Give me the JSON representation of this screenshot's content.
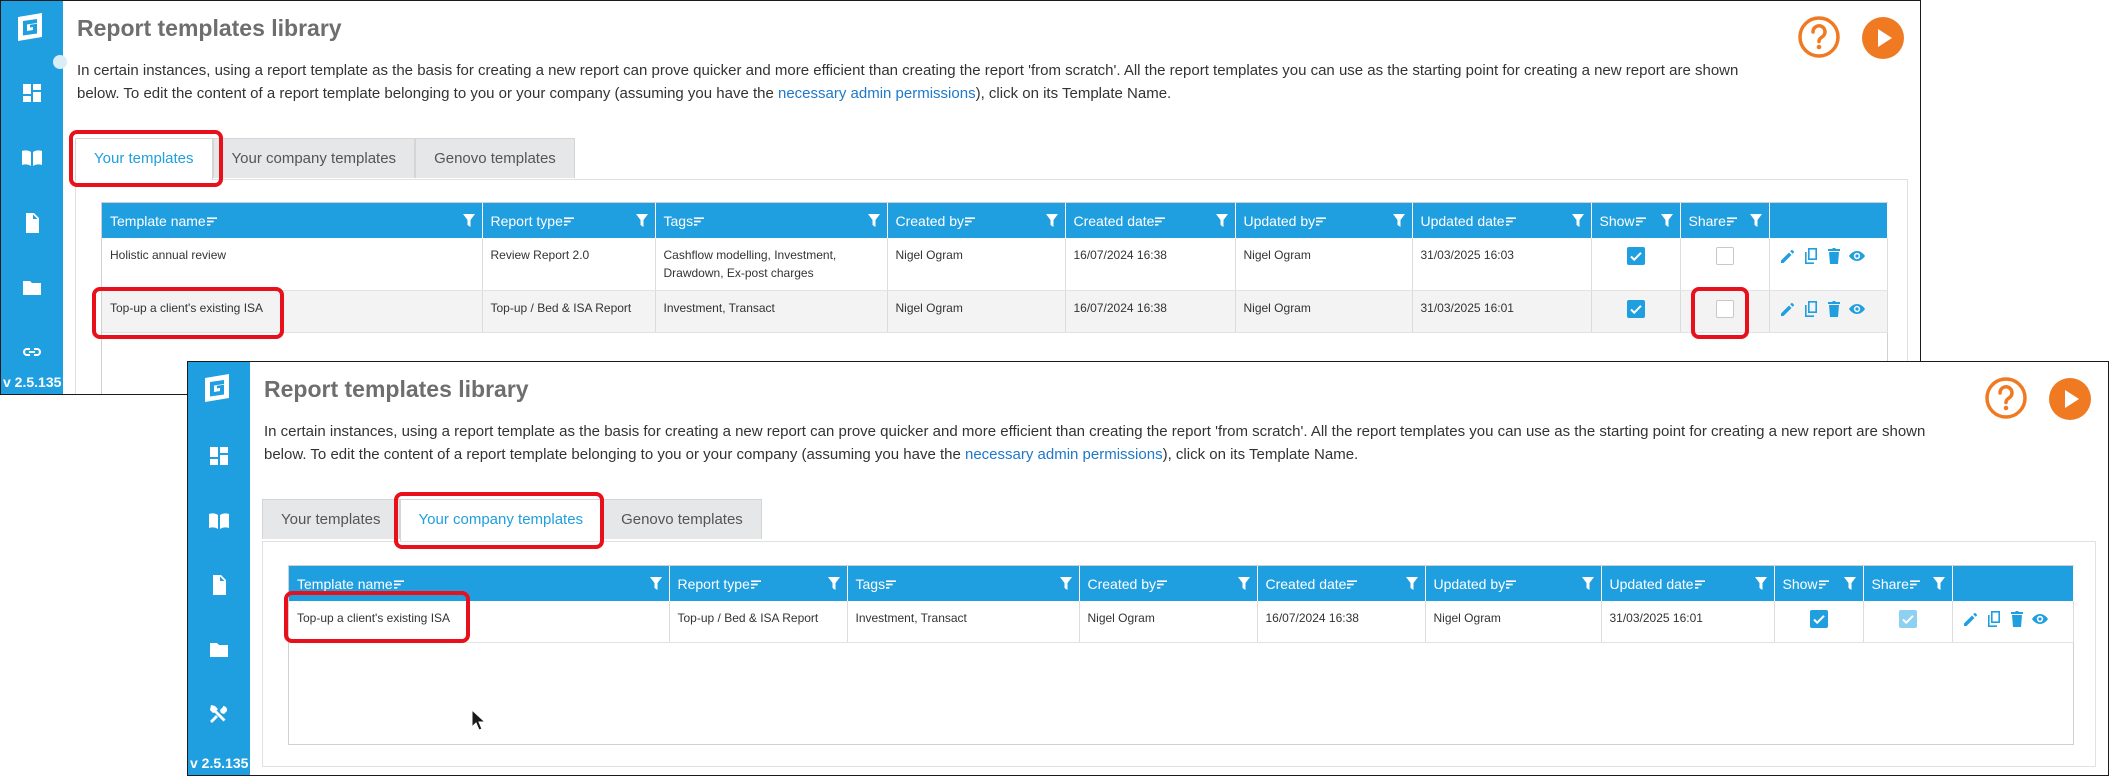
{
  "app": {
    "title": "Report templates library",
    "version": "v 2.5.135",
    "intro_part1": "In certain instances, using a report template as the basis for creating a new report can prove quicker and more efficient than creating the report 'from scratch'. All the report templates you can use as the starting point for creating a new report are shown below. To edit the content of a report template belonging to you or your company (assuming you have the ",
    "intro_link": "necessary admin permissions",
    "intro_part2": "), click on its Template Name."
  },
  "sidebar_icons": [
    "dashboard-icon",
    "book-icon",
    "document-icon",
    "folder-icon",
    "link-icon"
  ],
  "sidebar_icons_2": [
    "dashboard-icon",
    "book-icon",
    "document-icon",
    "folder-icon",
    "tools-icon"
  ],
  "tabs": [
    {
      "label": "Your templates"
    },
    {
      "label": "Your company templates"
    },
    {
      "label": "Genovo templates"
    }
  ],
  "shot1": {
    "active_tab": 0,
    "columns": [
      "Template name",
      "Report type",
      "Tags",
      "Created by",
      "Created date",
      "Updated by",
      "Updated date",
      "Show",
      "Share"
    ],
    "rows": [
      {
        "name": "Holistic annual review",
        "type": "Review Report 2.0",
        "tags": "Cashflow modelling, Investment, Drawdown, Ex-post charges",
        "created_by": "Nigel Ogram",
        "created_date": "16/07/2024 16:38",
        "updated_by": "Nigel Ogram",
        "updated_date": "31/03/2025 16:03",
        "show": true,
        "share": false
      },
      {
        "name": "Top-up a client's existing ISA",
        "type": "Top-up / Bed & ISA Report",
        "tags": "Investment, Transact",
        "created_by": "Nigel Ogram",
        "created_date": "16/07/2024 16:38",
        "updated_by": "Nigel Ogram",
        "updated_date": "31/03/2025 16:01",
        "show": true,
        "share": false
      }
    ]
  },
  "shot2": {
    "active_tab": 1,
    "columns": [
      "Template name",
      "Report type",
      "Tags",
      "Created by",
      "Created date",
      "Updated by",
      "Updated date",
      "Show",
      "Share"
    ],
    "rows": [
      {
        "name": "Top-up a client's existing ISA",
        "type": "Top-up / Bed & ISA Report",
        "tags": "Investment, Transact",
        "created_by": "Nigel Ogram",
        "created_date": "16/07/2024 16:38",
        "updated_by": "Nigel Ogram",
        "updated_date": "31/03/2025 16:01",
        "show": true,
        "share": true
      }
    ]
  },
  "colors": {
    "brand_blue": "#1f9fe0",
    "accent_orange": "#f07a22",
    "highlight_red": "#e8101a"
  }
}
